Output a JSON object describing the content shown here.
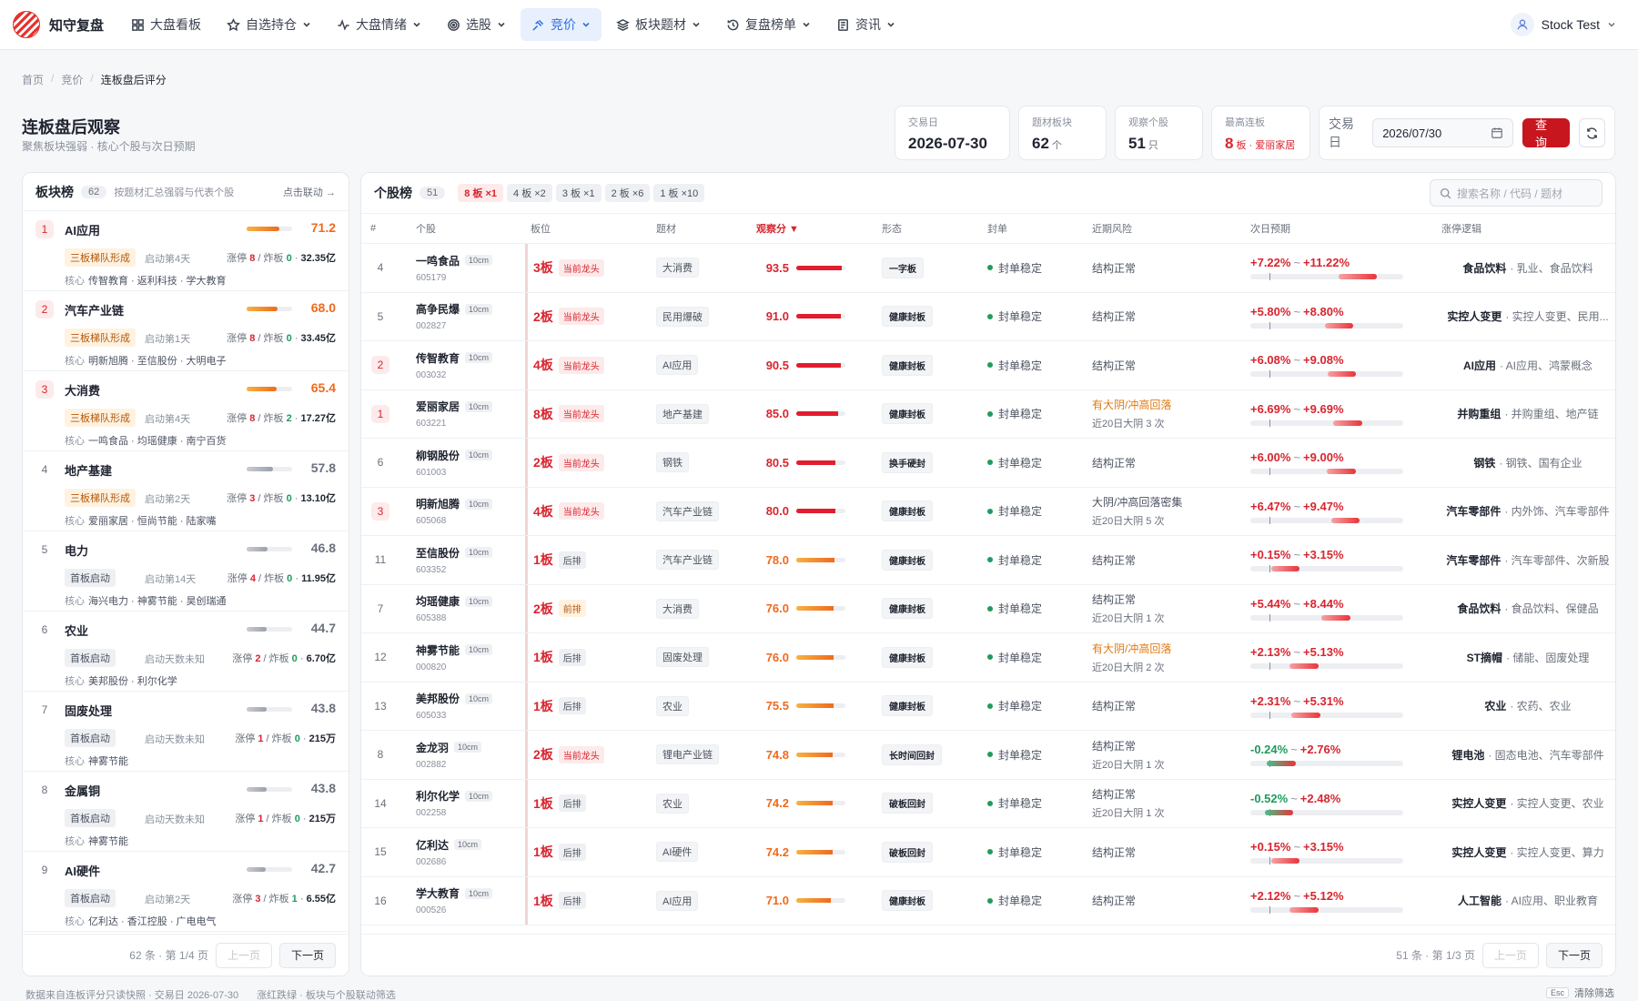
{
  "app": {
    "name": "知守复盘",
    "user": "Stock Test"
  },
  "nav": [
    {
      "label": "大盘看板",
      "icon": "grid-icon",
      "dropdown": false,
      "active": false
    },
    {
      "label": "自选持仓",
      "icon": "star-icon",
      "dropdown": true,
      "active": false
    },
    {
      "label": "大盘情绪",
      "icon": "pulse-icon",
      "dropdown": true,
      "active": false
    },
    {
      "label": "选股",
      "icon": "target-icon",
      "dropdown": true,
      "active": false
    },
    {
      "label": "竞价",
      "icon": "gavel-icon",
      "dropdown": true,
      "active": true
    },
    {
      "label": "板块题材",
      "icon": "layers-icon",
      "dropdown": true,
      "active": false
    },
    {
      "label": "复盘榜单",
      "icon": "history-icon",
      "dropdown": true,
      "active": false
    },
    {
      "label": "资讯",
      "icon": "news-icon",
      "dropdown": true,
      "active": false
    }
  ],
  "breadcrumb": [
    "首页",
    "竞价",
    "连板盘后评分"
  ],
  "page": {
    "title": "连板盘后观察",
    "subtitle": "聚焦板块强弱 · 核心个股与次日预期"
  },
  "stats": [
    {
      "label": "交易日",
      "value": "2026-07-30",
      "unit": ""
    },
    {
      "label": "题材板块",
      "value": "62",
      "unit": "个"
    },
    {
      "label": "观察个股",
      "value": "51",
      "unit": "只"
    },
    {
      "label": "最高连板",
      "value": "8",
      "unit": "板 · 爱丽家居"
    }
  ],
  "query": {
    "label": "交易日",
    "date": "2026/07/30",
    "button": "查询"
  },
  "sector_panel": {
    "title": "板块榜",
    "count": "62",
    "desc": "按题材汇总强弱与代表个股",
    "link": "点击联动 →",
    "sectors": [
      {
        "rank": "1",
        "name": "AI应用",
        "score": "71.2",
        "score_pct": 71.2,
        "tag": "三板梯队形成",
        "tag_type": "o",
        "start": "启动第4天",
        "zt": "8",
        "zb": "0",
        "amount": "32.35亿",
        "core_label": "核心",
        "core": "传智教育 · 返利科技 · 学大教育"
      },
      {
        "rank": "2",
        "name": "汽车产业链",
        "score": "68.0",
        "score_pct": 68.0,
        "tag": "三板梯队形成",
        "tag_type": "o",
        "start": "启动第1天",
        "zt": "8",
        "zb": "0",
        "amount": "33.45亿",
        "core_label": "核心",
        "core": "明新旭腾 · 至信股份 · 大明电子"
      },
      {
        "rank": "3",
        "name": "大消费",
        "score": "65.4",
        "score_pct": 65.4,
        "tag": "三板梯队形成",
        "tag_type": "o",
        "start": "启动第4天",
        "zt": "8",
        "zb": "2",
        "amount": "17.27亿",
        "core_label": "核心",
        "core": "一鸣食品 · 均瑶健康 · 南宁百货"
      },
      {
        "rank": "4",
        "name": "地产基建",
        "score": "57.8",
        "score_pct": 57.8,
        "tag": "三板梯队形成",
        "tag_type": "o",
        "start": "启动第2天",
        "zt": "3",
        "zb": "0",
        "amount": "13.10亿",
        "core_label": "核心",
        "core": "爱丽家居 · 恒尚节能 · 陆家嘴"
      },
      {
        "rank": "5",
        "name": "电力",
        "score": "46.8",
        "score_pct": 46.8,
        "tag": "首板启动",
        "tag_type": "g",
        "start": "启动第14天",
        "zt": "4",
        "zb": "0",
        "amount": "11.95亿",
        "core_label": "核心",
        "core": "海兴电力 · 神雾节能 · 昊创瑞通"
      },
      {
        "rank": "6",
        "name": "农业",
        "score": "44.7",
        "score_pct": 44.7,
        "tag": "首板启动",
        "tag_type": "g",
        "start": "启动天数未知",
        "zt": "2",
        "zb": "0",
        "amount": "6.70亿",
        "core_label": "核心",
        "core": "美邦股份 · 利尔化学"
      },
      {
        "rank": "7",
        "name": "固废处理",
        "score": "43.8",
        "score_pct": 43.8,
        "tag": "首板启动",
        "tag_type": "g",
        "start": "启动天数未知",
        "zt": "1",
        "zb": "0",
        "amount": "215万",
        "core_label": "核心",
        "core": "神雾节能"
      },
      {
        "rank": "8",
        "name": "金属铜",
        "score": "43.8",
        "score_pct": 43.8,
        "tag": "首板启动",
        "tag_type": "g",
        "start": "启动天数未知",
        "zt": "1",
        "zb": "0",
        "amount": "215万",
        "core_label": "核心",
        "core": "神雾节能"
      },
      {
        "rank": "9",
        "name": "AI硬件",
        "score": "42.7",
        "score_pct": 42.7,
        "tag": "首板启动",
        "tag_type": "g",
        "start": "启动第2天",
        "zt": "3",
        "zb": "1",
        "amount": "6.55亿",
        "core_label": "核心",
        "core": "亿利达 · 香江控股 · 广电电气"
      }
    ],
    "labels": {
      "zt": "涨停",
      "zb": "炸板"
    },
    "pager": {
      "info": "62 条 · 第 1/4 页",
      "prev": "上一页",
      "next": "下一页"
    }
  },
  "stock_panel": {
    "title": "个股榜",
    "count": "51",
    "chips": [
      "8 板 ×1",
      "4 板 ×2",
      "3 板 ×1",
      "2 板 ×6",
      "1 板 ×10"
    ],
    "search_placeholder": "搜索名称 / 代码 / 题材",
    "columns": [
      "#",
      "个股",
      "板位",
      "题材",
      "观察分 ▼",
      "形态",
      "封单",
      "近期风险",
      "次日预期",
      "涨停逻辑"
    ],
    "rows": [
      {
        "idx": "4",
        "hot": false,
        "name": "一鸣食品",
        "cm": "10cm",
        "code": "605179",
        "board": "3板",
        "lead": "当前龙头",
        "lt": "lead",
        "theme": "大消费",
        "score": "93.5",
        "score_pct": 93.5,
        "shape": "一字板",
        "seal": "封单稳定",
        "risk": "结构正常",
        "risk_warn": false,
        "risk_sub": "",
        "lo": "+7.22%",
        "hi": "+11.22%",
        "lo_v": 7.22,
        "hi_v": 11.22,
        "logic_b": "食品饮料",
        "logic": "· 乳业、食品饮料"
      },
      {
        "idx": "5",
        "hot": false,
        "name": "高争民爆",
        "cm": "10cm",
        "code": "002827",
        "board": "2板",
        "lead": "当前龙头",
        "lt": "lead",
        "theme": "民用爆破",
        "score": "91.0",
        "score_pct": 91.0,
        "shape": "健康封板",
        "seal": "封单稳定",
        "risk": "结构正常",
        "risk_warn": false,
        "risk_sub": "",
        "lo": "+5.80%",
        "hi": "+8.80%",
        "lo_v": 5.8,
        "hi_v": 8.8,
        "logic_b": "实控人变更",
        "logic": "· 实控人变更、民用..."
      },
      {
        "idx": "2",
        "hot": true,
        "name": "传智教育",
        "cm": "10cm",
        "code": "003032",
        "board": "4板",
        "lead": "当前龙头",
        "lt": "lead",
        "theme": "AI应用",
        "score": "90.5",
        "score_pct": 90.5,
        "shape": "健康封板",
        "seal": "封单稳定",
        "risk": "结构正常",
        "risk_warn": false,
        "risk_sub": "",
        "lo": "+6.08%",
        "hi": "+9.08%",
        "lo_v": 6.08,
        "hi_v": 9.08,
        "logic_b": "AI应用",
        "logic": "· AI应用、鸿蒙概念"
      },
      {
        "idx": "1",
        "hot": true,
        "name": "爱丽家居",
        "cm": "10cm",
        "code": "603221",
        "board": "8板",
        "lead": "当前龙头",
        "lt": "lead",
        "theme": "地产基建",
        "score": "85.0",
        "score_pct": 85.0,
        "shape": "健康封板",
        "seal": "封单稳定",
        "risk": "有大阴/冲高回落",
        "risk_warn": true,
        "risk_sub": "近20日大阴 3 次",
        "lo": "+6.69%",
        "hi": "+9.69%",
        "lo_v": 6.69,
        "hi_v": 9.69,
        "logic_b": "并购重组",
        "logic": "· 并购重组、地产链"
      },
      {
        "idx": "6",
        "hot": false,
        "name": "柳钢股份",
        "cm": "10cm",
        "code": "601003",
        "board": "2板",
        "lead": "当前龙头",
        "lt": "lead",
        "theme": "钢铁",
        "score": "80.5",
        "score_pct": 80.5,
        "shape": "换手硬封",
        "seal": "封单稳定",
        "risk": "结构正常",
        "risk_warn": false,
        "risk_sub": "",
        "lo": "+6.00%",
        "hi": "+9.00%",
        "lo_v": 6.0,
        "hi_v": 9.0,
        "logic_b": "钢铁",
        "logic": "· 钢铁、国有企业"
      },
      {
        "idx": "3",
        "hot": true,
        "name": "明新旭腾",
        "cm": "10cm",
        "code": "605068",
        "board": "4板",
        "lead": "当前龙头",
        "lt": "lead",
        "theme": "汽车产业链",
        "score": "80.0",
        "score_pct": 80.0,
        "shape": "健康封板",
        "seal": "封单稳定",
        "risk": "大阴/冲高回落密集",
        "risk_warn": false,
        "risk_sub": "近20日大阴 5 次",
        "lo": "+6.47%",
        "hi": "+9.47%",
        "lo_v": 6.47,
        "hi_v": 9.47,
        "logic_b": "汽车零部件",
        "logic": "· 内外饰、汽车零部件"
      },
      {
        "idx": "11",
        "hot": false,
        "name": "至信股份",
        "cm": "10cm",
        "code": "603352",
        "board": "1板",
        "lead": "后排",
        "lt": "back",
        "theme": "汽车产业链",
        "score": "78.0",
        "score_pct": 78.0,
        "shape": "健康封板",
        "seal": "封单稳定",
        "risk": "结构正常",
        "risk_warn": false,
        "risk_sub": "",
        "lo": "+0.15%",
        "hi": "+3.15%",
        "lo_v": 0.15,
        "hi_v": 3.15,
        "logic_b": "汽车零部件",
        "logic": "· 汽车零部件、次新股"
      },
      {
        "idx": "7",
        "hot": false,
        "name": "均瑶健康",
        "cm": "10cm",
        "code": "605388",
        "board": "2板",
        "lead": "前排",
        "lt": "front",
        "theme": "大消费",
        "score": "76.0",
        "score_pct": 76.0,
        "shape": "健康封板",
        "seal": "封单稳定",
        "risk": "结构正常",
        "risk_warn": false,
        "risk_sub": "近20日大阴 1 次",
        "lo": "+5.44%",
        "hi": "+8.44%",
        "lo_v": 5.44,
        "hi_v": 8.44,
        "logic_b": "食品饮料",
        "logic": "· 食品饮料、保健品"
      },
      {
        "idx": "12",
        "hot": false,
        "name": "神雾节能",
        "cm": "10cm",
        "code": "000820",
        "board": "1板",
        "lead": "后排",
        "lt": "back",
        "theme": "固废处理",
        "score": "76.0",
        "score_pct": 76.0,
        "shape": "健康封板",
        "seal": "封单稳定",
        "risk": "有大阴/冲高回落",
        "risk_warn": true,
        "risk_sub": "近20日大阴 2 次",
        "lo": "+2.13%",
        "hi": "+5.13%",
        "lo_v": 2.13,
        "hi_v": 5.13,
        "logic_b": "ST摘帽",
        "logic": "· 储能、固废处理"
      },
      {
        "idx": "13",
        "hot": false,
        "name": "美邦股份",
        "cm": "10cm",
        "code": "605033",
        "board": "1板",
        "lead": "后排",
        "lt": "back",
        "theme": "农业",
        "score": "75.5",
        "score_pct": 75.5,
        "shape": "健康封板",
        "seal": "封单稳定",
        "risk": "结构正常",
        "risk_warn": false,
        "risk_sub": "",
        "lo": "+2.31%",
        "hi": "+5.31%",
        "lo_v": 2.31,
        "hi_v": 5.31,
        "logic_b": "农业",
        "logic": "· 农药、农业"
      },
      {
        "idx": "8",
        "hot": false,
        "name": "金龙羽",
        "cm": "10cm",
        "code": "002882",
        "board": "2板",
        "lead": "当前龙头",
        "lt": "lead",
        "theme": "锂电产业链",
        "score": "74.8",
        "score_pct": 74.8,
        "shape": "长时间回封",
        "seal": "封单稳定",
        "risk": "结构正常",
        "risk_warn": false,
        "risk_sub": "近20日大阴 1 次",
        "lo": "-0.24%",
        "hi": "+2.76%",
        "lo_v": -0.24,
        "hi_v": 2.76,
        "logic_b": "锂电池",
        "logic": "· 固态电池、汽车零部件"
      },
      {
        "idx": "14",
        "hot": false,
        "name": "利尔化学",
        "cm": "10cm",
        "code": "002258",
        "board": "1板",
        "lead": "后排",
        "lt": "back",
        "theme": "农业",
        "score": "74.2",
        "score_pct": 74.2,
        "shape": "破板回封",
        "seal": "封单稳定",
        "risk": "结构正常",
        "risk_warn": false,
        "risk_sub": "近20日大阴 1 次",
        "lo": "-0.52%",
        "hi": "+2.48%",
        "lo_v": -0.52,
        "hi_v": 2.48,
        "logic_b": "实控人变更",
        "logic": "· 实控人变更、农业"
      },
      {
        "idx": "15",
        "hot": false,
        "name": "亿利达",
        "cm": "10cm",
        "code": "002686",
        "board": "1板",
        "lead": "后排",
        "lt": "back",
        "theme": "AI硬件",
        "score": "74.2",
        "score_pct": 74.2,
        "shape": "破板回封",
        "seal": "封单稳定",
        "risk": "结构正常",
        "risk_warn": false,
        "risk_sub": "",
        "lo": "+0.15%",
        "hi": "+3.15%",
        "lo_v": 0.15,
        "hi_v": 3.15,
        "logic_b": "实控人变更",
        "logic": "· 实控人变更、算力"
      },
      {
        "idx": "16",
        "hot": false,
        "name": "学大教育",
        "cm": "10cm",
        "code": "000526",
        "board": "1板",
        "lead": "后排",
        "lt": "back",
        "theme": "AI应用",
        "score": "71.0",
        "score_pct": 71.0,
        "shape": "健康封板",
        "seal": "封单稳定",
        "risk": "结构正常",
        "risk_warn": false,
        "risk_sub": "",
        "lo": "+2.12%",
        "hi": "+5.12%",
        "lo_v": 2.12,
        "hi_v": 5.12,
        "logic_b": "人工智能",
        "logic": "· AI应用、职业教育"
      }
    ],
    "pager": {
      "info": "51 条 · 第 1/3 页",
      "prev": "上一页",
      "next": "下一页"
    }
  },
  "footer": {
    "left1": "数据来自连板评分只读快照 · 交易日 2026-07-30",
    "left2": "涨红跌绿 · 板块与个股联动筛选",
    "key": "Esc",
    "right": "清除筛选"
  },
  "colors": {
    "accent": "#2f6fe4",
    "red": "#d8252f",
    "green": "#1f9b5e",
    "orange": "#e07a12",
    "primary_btn": "#c8161e"
  }
}
